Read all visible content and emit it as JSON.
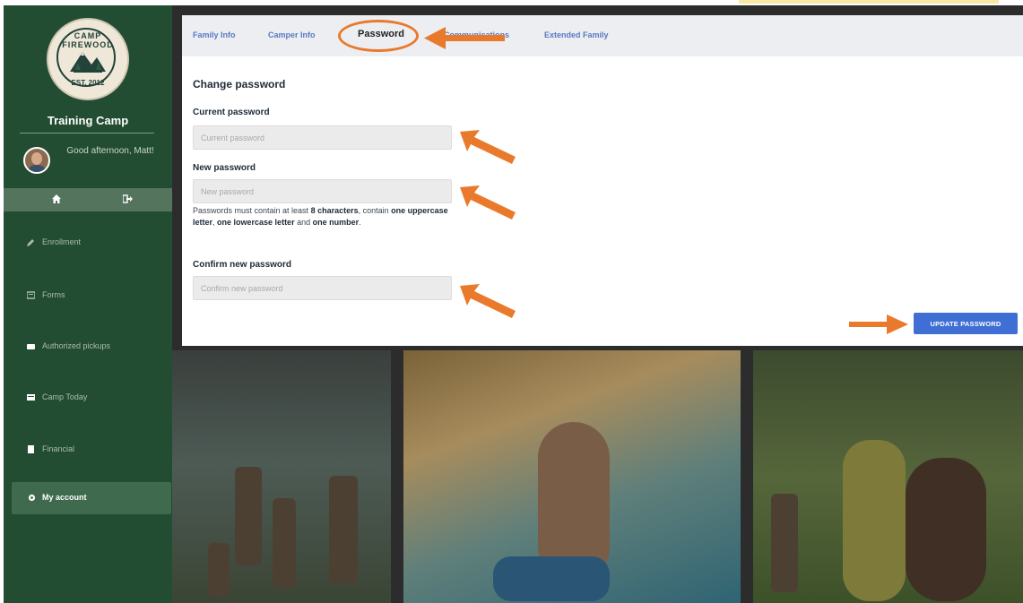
{
  "sidebar": {
    "logo": {
      "top_text": "CAMP FIREWOOD",
      "bottom_text": "EST. 2012"
    },
    "camp_name": "Training Camp",
    "greeting": "Good afternoon, Matt!",
    "actions": {
      "home_icon": "home-icon",
      "logout_icon": "logout-icon"
    },
    "nav": [
      {
        "label": "Enrollment",
        "icon": "pencil-icon"
      },
      {
        "label": "Forms",
        "icon": "forms-icon"
      },
      {
        "label": "Authorized pickups",
        "icon": "car-icon"
      },
      {
        "label": "Camp Today",
        "icon": "camp-today-icon"
      },
      {
        "label": "Financial",
        "icon": "financial-icon"
      },
      {
        "label": "My account",
        "icon": "gear-icon",
        "active": true
      }
    ]
  },
  "tabs": [
    {
      "label": "Family Info"
    },
    {
      "label": "Camper Info"
    },
    {
      "label": "Password",
      "active": true
    },
    {
      "label": "Communications"
    },
    {
      "label": "Extended Family"
    }
  ],
  "form": {
    "heading": "Change password",
    "current": {
      "label": "Current password",
      "placeholder": "Current password",
      "value": ""
    },
    "new": {
      "label": "New password",
      "placeholder": "New password",
      "value": ""
    },
    "help": {
      "t1": "Passwords must contain at least ",
      "b1": "8 characters",
      "t2": ", contain ",
      "b2": "one uppercase letter",
      "t3": ", ",
      "b3": "one lowercase letter",
      "t4": " and ",
      "b4": "one number",
      "t5": "."
    },
    "confirm": {
      "label": "Confirm new password",
      "placeholder": "Confirm new password",
      "value": ""
    },
    "submit_label": "UPDATE PASSWORD"
  },
  "colors": {
    "sidebar": "#234d32",
    "accent_button": "#3f6ed4",
    "annotation_arrow": "#e97a2c",
    "tab_link": "#5b78c2"
  }
}
